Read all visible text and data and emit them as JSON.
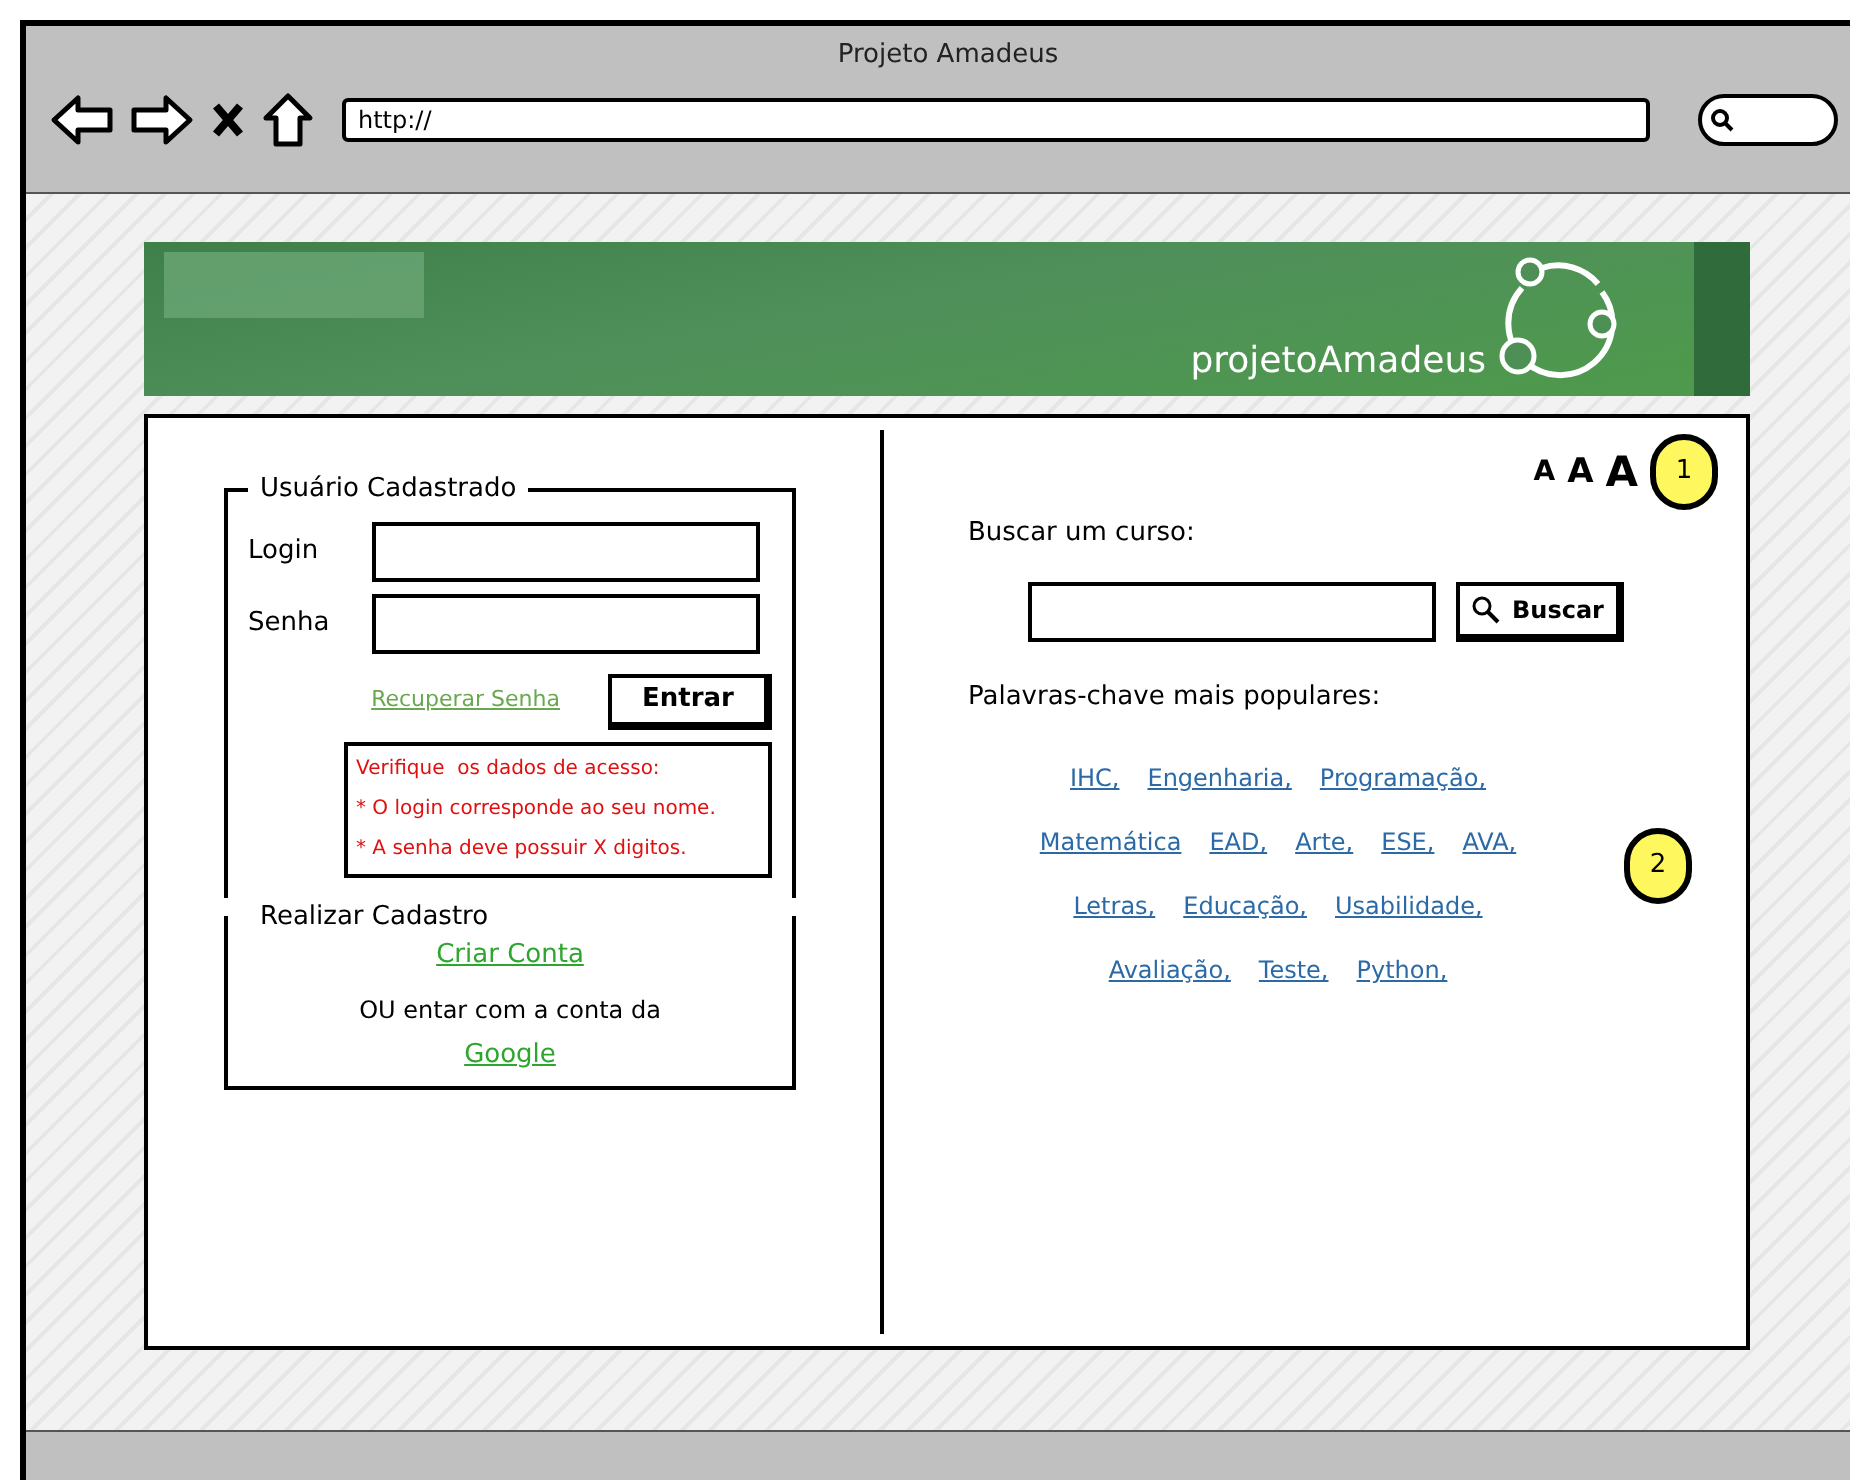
{
  "window": {
    "title": "Projeto Amadeus"
  },
  "address_bar": {
    "value": "http://"
  },
  "banner": {
    "logo_text": "projetoAmadeus"
  },
  "login": {
    "legend": "Usuário Cadastrado",
    "fields": [
      {
        "label": "Login"
      },
      {
        "label": "Senha"
      }
    ],
    "recover_link": "Recuperar Senha",
    "submit": "Entrar",
    "error_lines": [
      "Verifique  os dados de acesso:",
      "* O login corresponde ao seu nome.",
      "* A senha deve possuir X digitos."
    ]
  },
  "signup": {
    "legend": "Realizar Cadastro",
    "create_link": "Criar Conta",
    "alt_text": "OU entar com a conta da",
    "google_link": "Google"
  },
  "font_sizes": [
    "A",
    "A",
    "A"
  ],
  "search": {
    "label": "Buscar um curso:",
    "button": "Buscar"
  },
  "keywords": {
    "title": "Palavras-chave mais populares:",
    "rows": [
      [
        "IHC,",
        "Engenharia,",
        "Programação,"
      ],
      [
        "Matemática",
        "EAD,",
        "Arte,",
        "ESE,",
        "AVA,"
      ],
      [
        "Letras,",
        "Educação,",
        "Usabilidade,"
      ],
      [
        "Avaliação,",
        "Teste,",
        "Python,"
      ]
    ]
  },
  "callouts": [
    "1",
    "2"
  ]
}
